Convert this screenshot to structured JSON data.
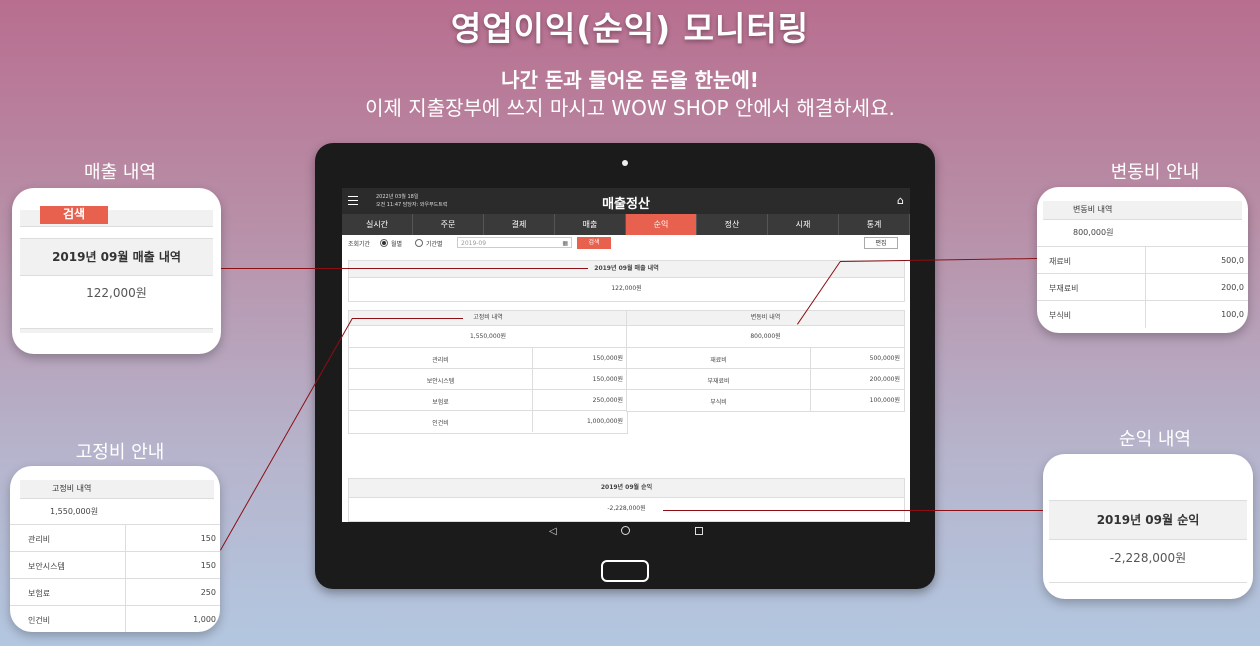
{
  "hero": {
    "title": "영업이익(순익) 모니터링",
    "subtitle": "나간 돈과 들어온 돈을 한눈에!",
    "description": "이제 지출장부에 쓰지 마시고 WOW SHOP 안에서 해결하세요."
  },
  "callouts": {
    "sales": {
      "label": "매출 내역",
      "search_button": "검색",
      "heading": "2019년 09월 매출 내역",
      "amount": "122,000원"
    },
    "variable": {
      "label": "변동비 안내",
      "heading": "변동비 내역",
      "total": "800,000원",
      "items": [
        {
          "name": "재료비",
          "value": "500,0"
        },
        {
          "name": "부재료비",
          "value": "200,0"
        },
        {
          "name": "부식비",
          "value": "100,0"
        }
      ]
    },
    "fixed": {
      "label": "고정비  안내",
      "heading": "고정비 내역",
      "total": "1,550,000원",
      "items": [
        {
          "name": "관리비",
          "value": "150"
        },
        {
          "name": "보안시스템",
          "value": "150"
        },
        {
          "name": "보험료",
          "value": "250"
        },
        {
          "name": "인건비",
          "value": "1,000"
        }
      ]
    },
    "net": {
      "label": "순익 내역",
      "heading": "2019년 09월 순익",
      "amount": "-2,228,000원"
    }
  },
  "app": {
    "date": "2022년 03월 18일",
    "time_user": "오전 11:47   담당자: 와우푸드트럭",
    "title": "매출정산",
    "tabs": [
      "실시간",
      "주문",
      "결제",
      "매출",
      "순익",
      "정산",
      "시재",
      "통계"
    ],
    "active_tab": 4,
    "filter": {
      "period_label": "조회기간",
      "monthly": "월별",
      "range": "기간별",
      "month_value": "2019-09",
      "search": "검색",
      "edit": "편집"
    },
    "sales": {
      "heading": "2019년 09월 매출 내역",
      "amount": "122,000원"
    },
    "fixed": {
      "heading": "고정비 내역",
      "total": "1,550,000원",
      "items": [
        {
          "name": "관리비",
          "value": "150,000원"
        },
        {
          "name": "보안시스템",
          "value": "150,000원"
        },
        {
          "name": "보험료",
          "value": "250,000원"
        },
        {
          "name": "인건비",
          "value": "1,000,000원"
        }
      ]
    },
    "variable": {
      "heading": "변동비 내역",
      "total": "800,000원",
      "items": [
        {
          "name": "재료비",
          "value": "500,000원"
        },
        {
          "name": "부재료비",
          "value": "200,000원"
        },
        {
          "name": "부식비",
          "value": "100,000원"
        }
      ]
    },
    "net": {
      "heading": "2019년 09월 순익",
      "amount": "-2,228,000원"
    }
  },
  "colors": {
    "accent": "#e8614f",
    "connector": "#8b0f14",
    "navbar": "#2b2b2b"
  },
  "icons": [
    "menu-icon",
    "home-icon",
    "calendar-icon",
    "back-icon",
    "circle-home-icon",
    "recent-apps-icon"
  ]
}
